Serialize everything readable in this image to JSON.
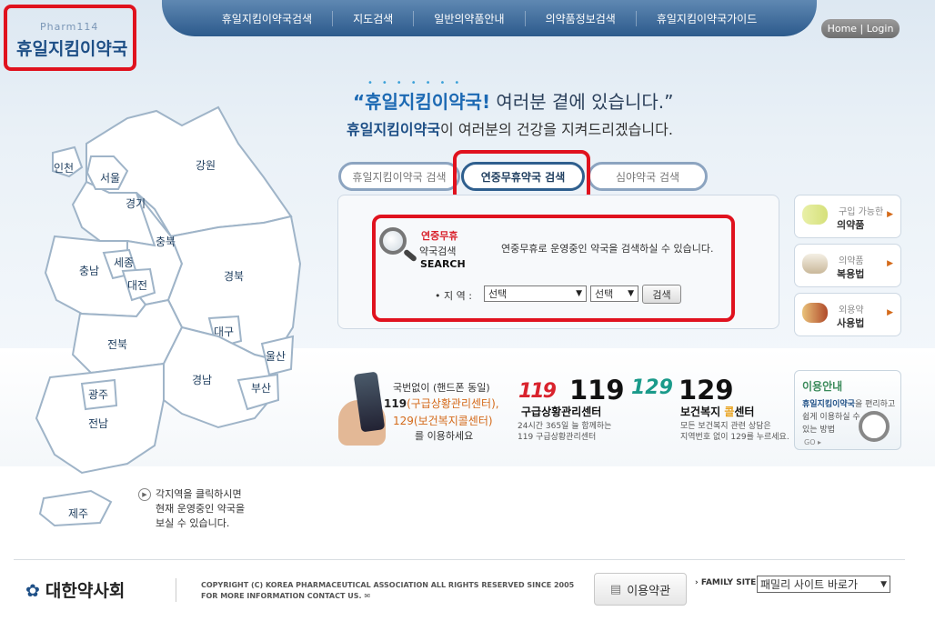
{
  "logo": {
    "small": "Pharm114",
    "name": "휴일지킴이약국"
  },
  "nav": [
    "휴일지킴이약국검색",
    "지도검색",
    "일반의약품안내",
    "의약품정보검색",
    "휴일지킴이약국가이드"
  ],
  "home_login": "Home | Login",
  "slogan": {
    "line1_emph": "“휴일지킴이약국",
    "line1_mark": "!",
    "line1_rest": " 여러분 곁에 있습니다.”",
    "line2_emph": "휴일지킴이약국",
    "line2_rest": "이 여러분의 건강을 지켜드리겠습니다."
  },
  "tabs": [
    "휴일지킴이약국 검색",
    "연중무휴약국 검색",
    "심야약국 검색"
  ],
  "search": {
    "label_line1": "연중무휴",
    "label_line2": "약국검색",
    "label_line3": "SEARCH",
    "description": "연중무휴로 운영중인 약국을 검색하실 수 있습니다.",
    "region_label": "• 지 역 :",
    "select1": "선택",
    "select2": "선택",
    "button": "검색"
  },
  "side_menu": [
    {
      "line1": "구입 가능한",
      "line2": "의약품"
    },
    {
      "line1": "의약품",
      "line2": "복용법"
    },
    {
      "line1": "외용약",
      "line2": "사용법"
    }
  ],
  "map_regions": [
    "인천",
    "서울",
    "경기",
    "강원",
    "충북",
    "충남",
    "세종",
    "대전",
    "경북",
    "대구",
    "전북",
    "경남",
    "울산",
    "광주",
    "부산",
    "전남",
    "제주"
  ],
  "map_note": [
    "각지역을 클릭하시면",
    "현재 운영중인 약국을",
    "보실 수 있습니다."
  ],
  "phone_info": {
    "line1": "국번없이 (핸드폰 동일)",
    "line2_num": "119",
    "line2_rest": "(구급상황관리센터),",
    "line3": "129(보건복지콜센터)",
    "line4": "를 이용하세요"
  },
  "info119": {
    "logo": "119",
    "number": "119",
    "title": "구급상황관리센터",
    "desc1": "24시간 365일 늘 함께하는",
    "desc2": "119 구급상황관리센터"
  },
  "info129": {
    "logo": "129",
    "number": "129",
    "title_a": "보건복지 ",
    "title_b": "콜",
    "title_c": "센터",
    "desc1": "모든 보건복지 관련 상담은",
    "desc2": "지역번호 없이 129를 누르세요."
  },
  "guide": {
    "title": "이용안내",
    "line1_emph": "휴일지킴이약국",
    "line1_rest": "을 편리하고",
    "line2": "쉽게 이용하실 수",
    "line3": "있는 방법",
    "go": "GO ▸"
  },
  "footer": {
    "org": "대한약사회",
    "copyright1": "COPYRIGHT (C) KOREA PHARMACEUTICAL ASSOCIATION ALL RIGHTS RESERVED SINCE 2005",
    "copyright2": "FOR MORE INFORMATION CONTACT US.",
    "terms": "이용약관",
    "family_label": "› FAMILY SITE",
    "family_select": "패밀리 사이트 바로가"
  },
  "colors": {
    "accent": "#1e4f86",
    "highlight": "#e0121e",
    "nav": "#2c5a8c",
    "map_fill": "#ffffff",
    "map_stroke": "#9fb4c8"
  }
}
